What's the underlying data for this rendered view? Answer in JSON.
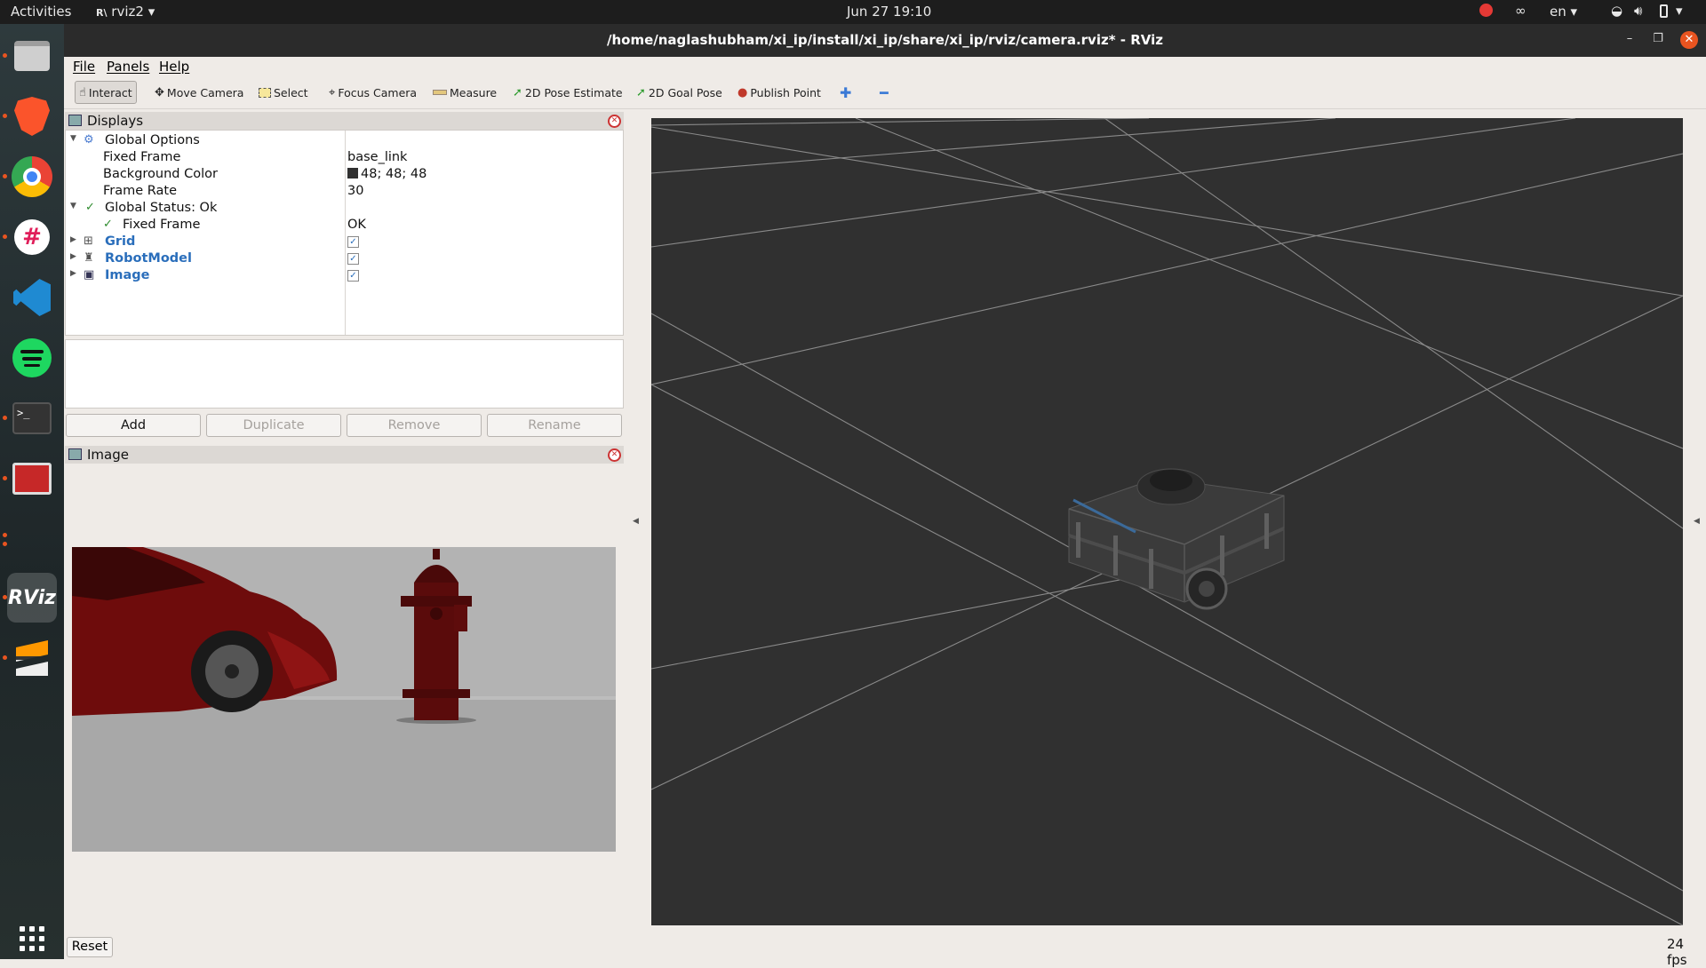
{
  "topbar": {
    "activities": "Activities",
    "app_menu": "rviz2",
    "clock": "Jun 27  19:10",
    "lang": "en"
  },
  "window": {
    "title": "/home/naglashubham/xi_ip/install/xi_ip/share/xi_ip/rviz/camera.rviz* - RViz"
  },
  "menubar": {
    "file": "File",
    "panels": "Panels",
    "help": "Help"
  },
  "toolbar": {
    "interact": "Interact",
    "move_camera": "Move Camera",
    "select": "Select",
    "focus_camera": "Focus Camera",
    "measure": "Measure",
    "pose_estimate": "2D Pose Estimate",
    "goal_pose": "2D Goal Pose",
    "publish_point": "Publish Point"
  },
  "displays": {
    "title": "Displays",
    "global_options": "Global Options",
    "fixed_frame_label": "Fixed Frame",
    "fixed_frame_value": "base_link",
    "bg_color_label": "Background Color",
    "bg_color_value": "48; 48; 48",
    "frame_rate_label": "Frame Rate",
    "frame_rate_value": "30",
    "global_status": "Global Status: Ok",
    "status_fixed_frame": "Fixed Frame",
    "status_fixed_frame_value": "OK",
    "grid": "Grid",
    "robot_model": "RobotModel",
    "image": "Image"
  },
  "buttons": {
    "add": "Add",
    "duplicate": "Duplicate",
    "remove": "Remove",
    "rename": "Rename"
  },
  "image_panel": {
    "title": "Image"
  },
  "footer": {
    "reset": "Reset",
    "fps": "24 fps"
  },
  "colors": {
    "viewport_bg": "#303030",
    "accent": "#e95420",
    "link_blue": "#2a6ebb"
  }
}
